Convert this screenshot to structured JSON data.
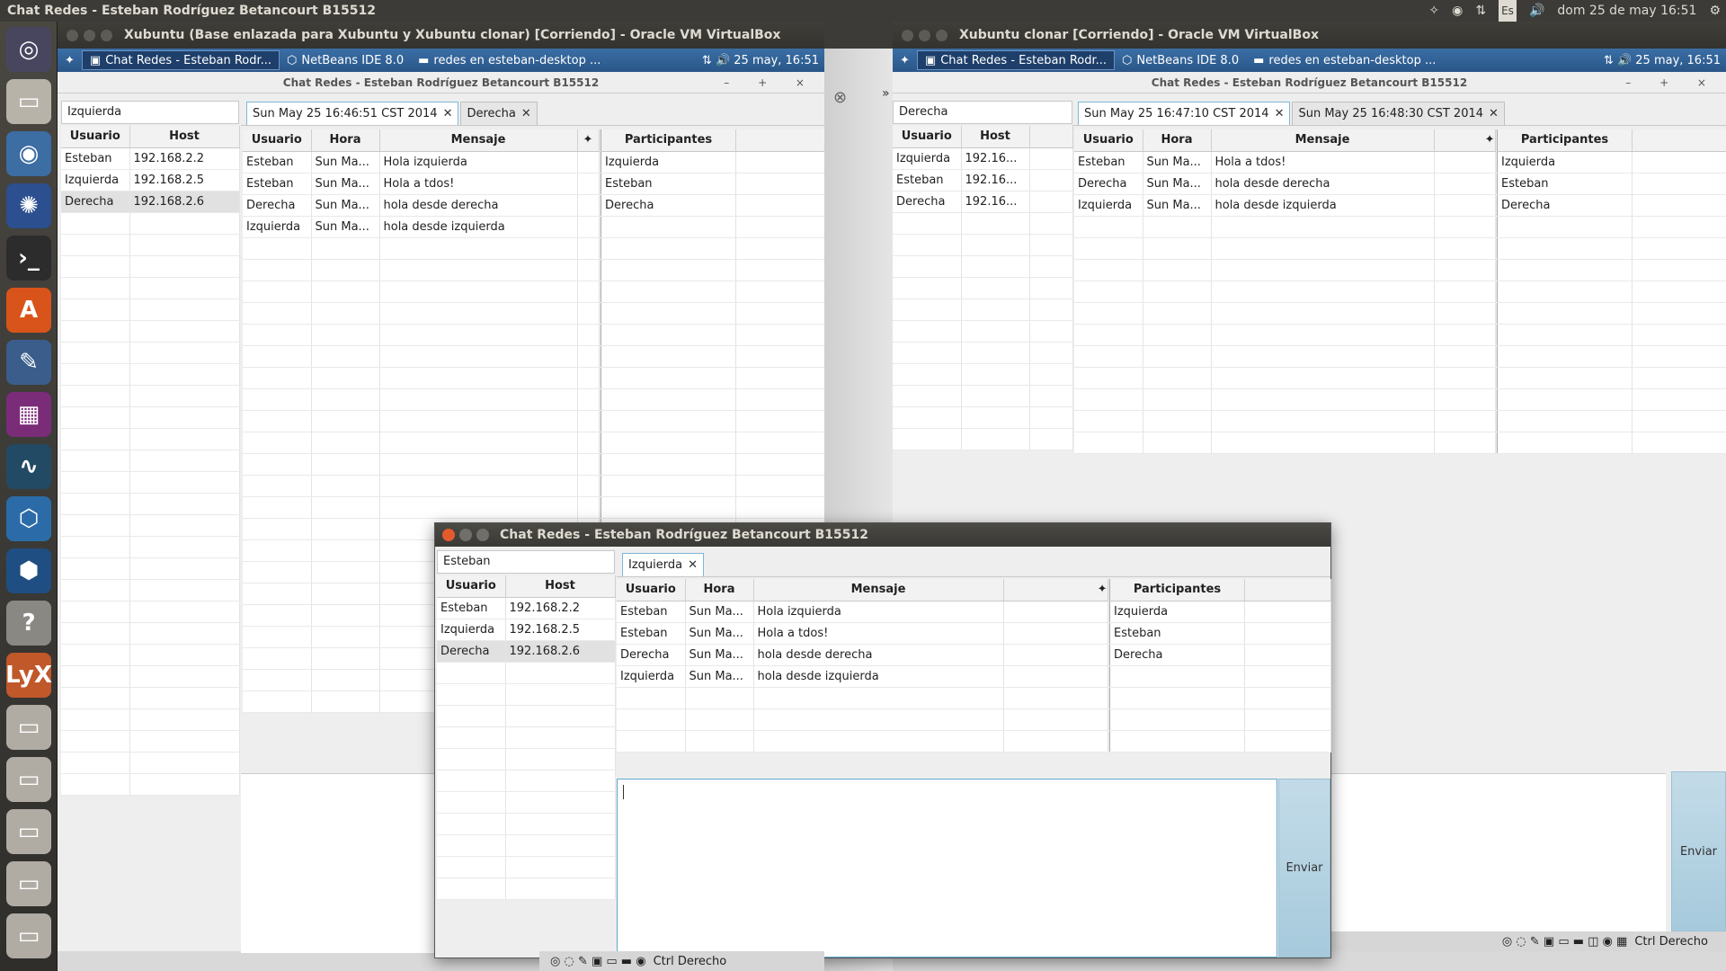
{
  "topbar": {
    "title": "Chat Redes - Esteban Rodríguez Betancourt B15512",
    "keyboard": "Es",
    "datetime": "dom 25 de may 16:51"
  },
  "launcher": {
    "items": [
      "ubuntu-dash",
      "files",
      "chrome",
      "firefox",
      "terminal",
      "software-center",
      "system-settings",
      "workspace",
      "system-monitor",
      "virtualbox",
      "virtualbox-vm",
      "help",
      "lyx",
      "drive",
      "drive",
      "drive",
      "drive",
      "drive"
    ]
  },
  "vm_left": {
    "title": "Xubuntu (Base enlazada para Xubuntu y Xubuntu clonar) [Corriendo] - Oracle VM VirtualBox",
    "taskbar": {
      "items": [
        "Chat Redes - Esteban Rodr...",
        "NetBeans IDE 8.0",
        "redes en esteban-desktop ..."
      ],
      "clock": "25 may, 16:51"
    },
    "app": {
      "title": "Chat Redes - Esteban Rodríguez Betancourt B15512",
      "controls": "– + ×",
      "name_field": "Izquierda",
      "users_headers": [
        "Usuario",
        "Host"
      ],
      "users": [
        [
          "Esteban",
          "192.168.2.2"
        ],
        [
          "Izquierda",
          "192.168.2.5"
        ],
        [
          "Derecha",
          "192.168.2.6"
        ]
      ],
      "tabs": [
        "Sun May 25 16:46:51 CST 2014",
        "Derecha"
      ],
      "msg_headers": [
        "Usuario",
        "Hora",
        "Mensaje",
        ""
      ],
      "messages": [
        [
          "Esteban",
          "Sun Ma...",
          "Hola izquierda"
        ],
        [
          "Esteban",
          "Sun Ma...",
          "Hola a tdos!"
        ],
        [
          "Derecha",
          "Sun Ma...",
          "hola desde derecha"
        ],
        [
          "Izquierda",
          "Sun Ma...",
          "hola desde izquierda"
        ]
      ],
      "part_header": "Participantes",
      "participants": [
        "Izquierda",
        "Esteban",
        "Derecha"
      ]
    }
  },
  "vm_right": {
    "title": "Xubuntu clonar [Corriendo] - Oracle VM VirtualBox",
    "taskbar": {
      "items": [
        "Chat Redes - Esteban Rodr...",
        "NetBeans IDE 8.0",
        "redes en esteban-desktop ..."
      ],
      "clock": "25 may, 16:51"
    },
    "app": {
      "title": "Chat Redes - Esteban Rodríguez Betancourt B15512",
      "controls": "– + ×",
      "name_field": "Derecha",
      "users_headers": [
        "Usuario",
        "Host"
      ],
      "users": [
        [
          "Izquierda",
          "192.16..."
        ],
        [
          "Esteban",
          "192.16..."
        ],
        [
          "Derecha",
          "192.16..."
        ]
      ],
      "tabs": [
        "Sun May 25 16:47:10 CST 2014",
        "Sun May 25 16:48:30 CST 2014"
      ],
      "msg_headers": [
        "Usuario",
        "Hora",
        "Mensaje",
        ""
      ],
      "messages": [
        [
          "Esteban",
          "Sun Ma...",
          "Hola a tdos!"
        ],
        [
          "Derecha",
          "Sun Ma...",
          "hola desde derecha"
        ],
        [
          "Izquierda",
          "Sun Ma...",
          "hola desde izquierda"
        ]
      ],
      "part_header": "Participantes",
      "participants": [
        "Izquierda",
        "Esteban",
        "Derecha"
      ],
      "send": "Enviar",
      "status": "Ctrl Derecho"
    }
  },
  "host_app": {
    "title": "Chat Redes - Esteban Rodríguez Betancourt B15512",
    "name_field": "Esteban",
    "users_headers": [
      "Usuario",
      "Host"
    ],
    "users": [
      [
        "Esteban",
        "192.168.2.2"
      ],
      [
        "Izquierda",
        "192.168.2.5"
      ],
      [
        "Derecha",
        "192.168.2.6"
      ]
    ],
    "tabs": [
      "Izquierda"
    ],
    "msg_headers": [
      "Usuario",
      "Hora",
      "Mensaje",
      ""
    ],
    "messages": [
      [
        "Esteban",
        "Sun Ma...",
        "Hola izquierda"
      ],
      [
        "Esteban",
        "Sun Ma...",
        "Hola a tdos!"
      ],
      [
        "Derecha",
        "Sun Ma...",
        "hola desde derecha"
      ],
      [
        "Izquierda",
        "Sun Ma...",
        "hola desde izquierda"
      ]
    ],
    "part_header": "Participantes",
    "participants": [
      "Izquierda",
      "Esteban",
      "Derecha"
    ],
    "send": "Enviar",
    "status": "Ctrl Derecho"
  },
  "colors": {
    "ubuntu_panel": "#3c3b37",
    "xfce_task": "#2a5688",
    "selection": "#e1e1e1",
    "send_btn": "#a6cadc"
  }
}
